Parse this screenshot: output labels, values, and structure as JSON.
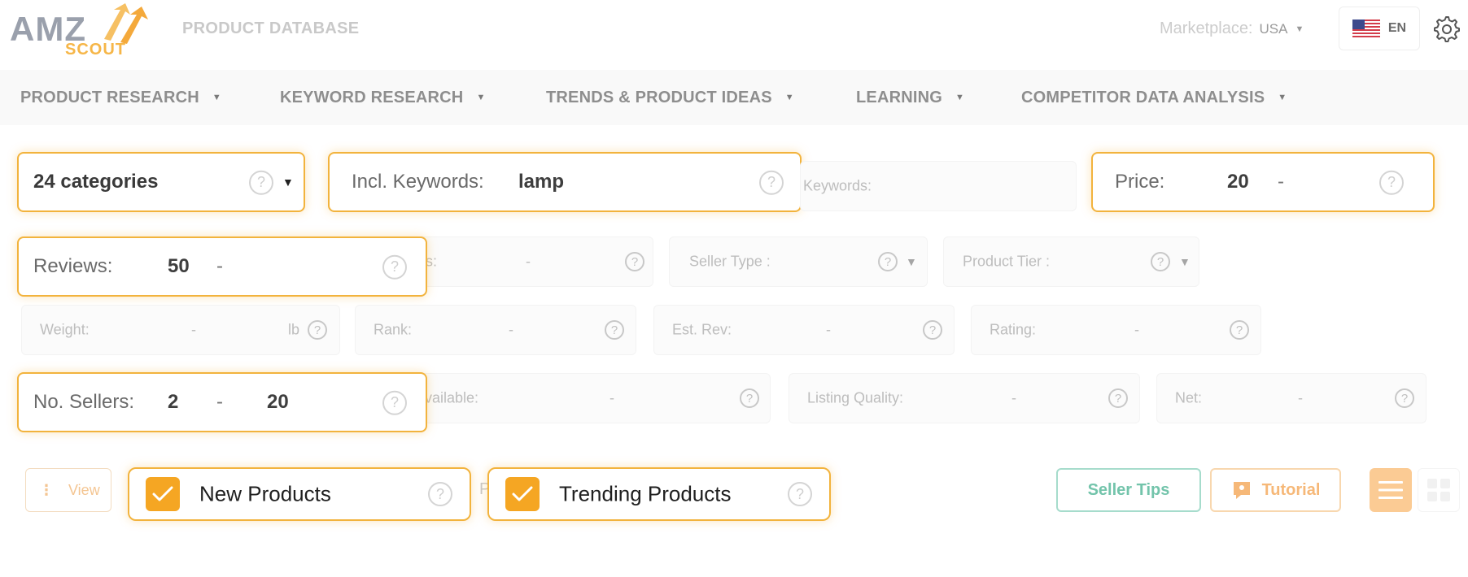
{
  "header": {
    "logo_text": "AMZ",
    "logo_subtext": "SCOUT",
    "page_title": "PRODUCT DATABASE",
    "marketplace_label": "Marketplace:",
    "marketplace_value": "USA",
    "language": "EN"
  },
  "nav": {
    "items": [
      {
        "label": "PRODUCT RESEARCH"
      },
      {
        "label": "KEYWORD RESEARCH"
      },
      {
        "label": "TRENDS & PRODUCT IDEAS"
      },
      {
        "label": "LEARNING"
      },
      {
        "label": "COMPETITOR DATA ANALYSIS"
      }
    ]
  },
  "filters": {
    "categories": {
      "value": "24 categories"
    },
    "incl_keywords": {
      "label": "Incl. Keywords:",
      "value": "lamp"
    },
    "excl_keywords": {
      "label": "Keywords:"
    },
    "price": {
      "label": "Price:",
      "min": "20",
      "dash": "-"
    },
    "reviews": {
      "label": "Reviews:",
      "min": "50",
      "dash": "-"
    },
    "hidden_s": {
      "label": "s:",
      "dash": "-"
    },
    "seller_type": {
      "label": "Seller Type :"
    },
    "product_tier": {
      "label": "Product Tier :"
    },
    "weight": {
      "label": "Weight:",
      "dash": "-",
      "unit": "lb"
    },
    "rank": {
      "label": "Rank:",
      "dash": "-"
    },
    "est_rev": {
      "label": "Est. Rev:",
      "dash": "-"
    },
    "rating": {
      "label": "Rating:",
      "dash": "-"
    },
    "no_sellers": {
      "label": "No. Sellers:",
      "min": "2",
      "dash": "-",
      "max": "20"
    },
    "available": {
      "label": "vailable:",
      "dash": "-"
    },
    "listing_quality": {
      "label": "Listing Quality:",
      "dash": "-"
    },
    "net": {
      "label": "Net:",
      "dash": "-"
    }
  },
  "toolbar": {
    "view_label": "View",
    "new_products_label": "New Products",
    "new_products_checked": true,
    "ghost_text": "P",
    "trending_products_label": "Trending Products",
    "trending_products_checked": true,
    "seller_tips_label": "Seller Tips",
    "tutorial_label": "Tutorial"
  },
  "help_glyph": "?",
  "colors": {
    "accent": "#f5a623",
    "highlight_border": "#f2b33d",
    "seller_tips": "#73c4ab",
    "tutorial": "#f6b878"
  }
}
